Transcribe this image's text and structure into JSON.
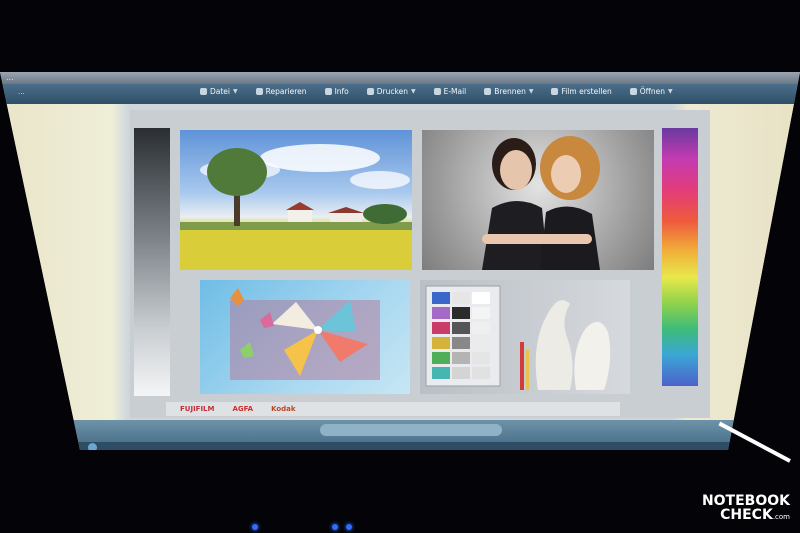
{
  "window": {
    "title": "..."
  },
  "toolbar": {
    "left_link": "...",
    "menu": [
      {
        "label": "Datei",
        "icon": "file-icon"
      },
      {
        "label": "Reparieren",
        "icon": "repair-icon"
      },
      {
        "label": "Info",
        "icon": "info-icon"
      },
      {
        "label": "Drucken",
        "icon": "printer-icon"
      },
      {
        "label": "E-Mail",
        "icon": "mail-icon"
      },
      {
        "label": "Brennen",
        "icon": "disc-icon"
      },
      {
        "label": "Film erstellen",
        "icon": "film-icon"
      },
      {
        "label": "Öffnen",
        "icon": "folder-icon"
      }
    ]
  },
  "testchart": {
    "sponsors": [
      "FUJIFILM",
      "AGFA",
      "Kodak"
    ]
  },
  "watermark": {
    "line1": "NOTEBOOK",
    "line2": "CHECK",
    "suffix": ".com"
  },
  "colors": {
    "taskbar": "#2e4d64",
    "toolbar": "#2f4f67",
    "led": "#2c6cff"
  }
}
